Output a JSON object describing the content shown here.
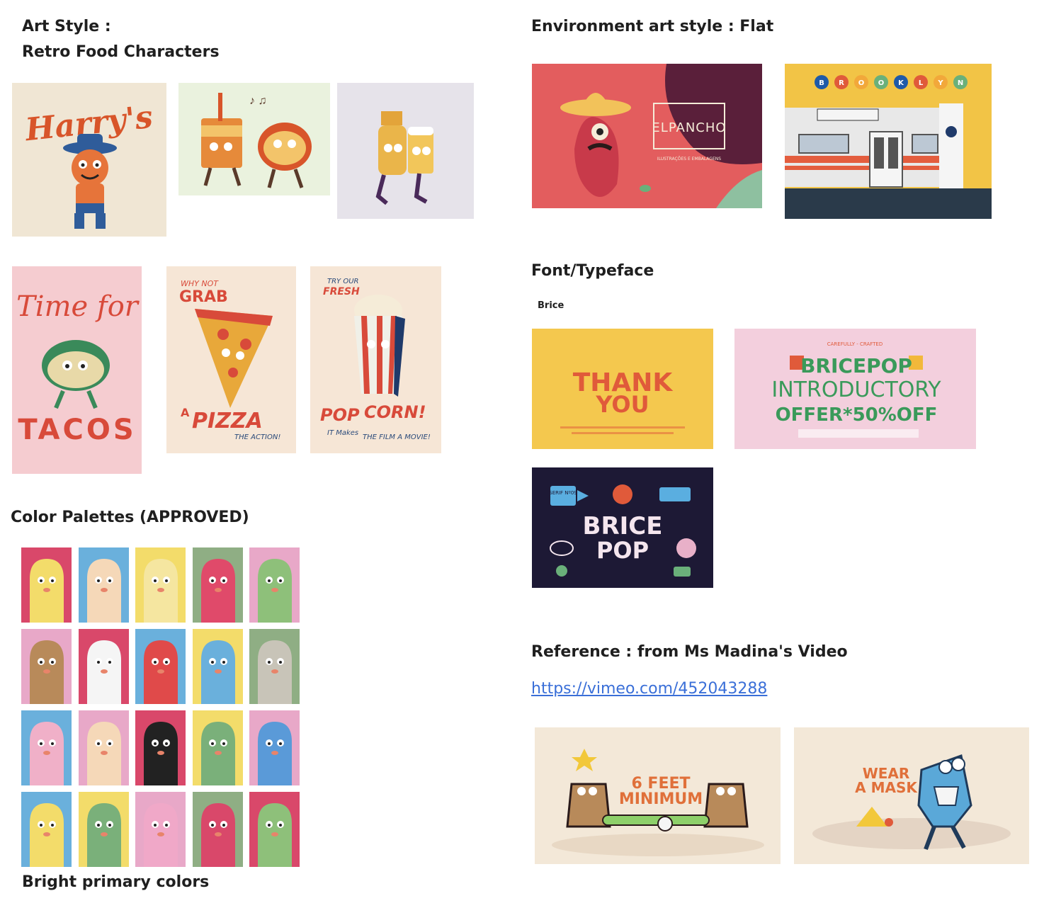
{
  "left": {
    "art_style_line1": "Art Style :",
    "art_style_line2": "Retro Food Characters",
    "palettes_heading": "Color Palettes (APPROVED)",
    "palettes_caption": "Bright primary colors",
    "images": {
      "harrys_text": "Harry's",
      "tacos_line1": "Time for",
      "tacos_line2": "TACOS",
      "pizza_top1": "WHY NOT",
      "pizza_top2": "GRAB",
      "pizza_mid": "A",
      "pizza_word": "PIZZA",
      "pizza_sub": "THE ACTION!",
      "pop_top1": "TRY OUR",
      "pop_top2": "FRESH",
      "pop_word1": "POP",
      "pop_word2": "CORN!",
      "pop_sub1": "IT Makes",
      "pop_sub2": "THE FILM A MOVIE!"
    }
  },
  "right": {
    "environment_heading": "Environment art style : Flat",
    "font_heading": "Font/Typeface",
    "font_name": "Brice",
    "reference_heading": "Reference : from Ms Madina's Video",
    "reference_link": "https://vimeo.com/452043288",
    "images": {
      "elpancho": "ELPANCHO",
      "elpancho_sub": "ILUSTRAÇÕES E EMBALAGENS",
      "brooklyn_letters": [
        "B",
        "R",
        "O",
        "O",
        "K",
        "L",
        "Y",
        "N"
      ],
      "thank_you_line1": "THANK",
      "thank_you_line2": "YOU",
      "bricepop_line1": "BRICEPOP",
      "bricepop_line2": "INTRODUCTORY",
      "bricepop_line3": "OFFER*50%OFF",
      "bricepop_top": "CAREFULLY - CRAFTED",
      "brice_big1": "BRICE",
      "brice_big2": "POP",
      "brice_serif": "SERIF Nº09",
      "feet_line1": "6 FEET",
      "feet_line2": "MINIMUM",
      "mask_line1": "WEAR",
      "mask_line2": "A MASK"
    }
  },
  "colors": {
    "pink": "#e8a8c8",
    "blue": "#6ab0dc",
    "yellow": "#f3dc6a",
    "green": "#8fae84",
    "red": "#d9486a"
  }
}
